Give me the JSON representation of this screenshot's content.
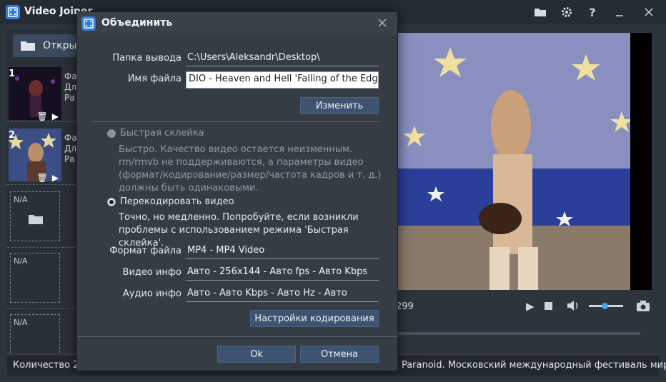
{
  "app": {
    "title": "Video Joiner",
    "open_button": "Откры",
    "status_left": "Количество 2",
    "status_right": "я Paranoid. Московский международный фестиваль мира",
    "time_display": "299",
    "clips": [
      {
        "index": "1",
        "side_lines": [
          "Фа",
          "Дл",
          "Ра"
        ]
      },
      {
        "index": "2",
        "side_lines": [
          "Фа",
          "Дл",
          "Ра"
        ]
      }
    ],
    "empty_slot_label": "N/A"
  },
  "dialog": {
    "title": "Объединить",
    "output_folder_label": "Папка вывода",
    "output_folder_value": "C:\\Users\\Aleksandr\\Desktop\\",
    "filename_label": "Имя файла",
    "filename_value": "DIO - Heaven and Hell 'Falling of the Edge o",
    "change_button": "Изменить",
    "fast_join_label": "Быстрая склейка",
    "fast_join_desc": "Быстро. Качество видео остается неизменным. rm/rmvb не поддерживаются, а параметры видео (формат/кодирование/размер/частота кадров и т. д.) должны быть одинаковыми.",
    "reencode_label": "Перекодировать видео",
    "reencode_desc": "Точно, но медленно. Попробуйте, если возникли проблемы с использованием режима 'Быстрая склейка'.",
    "format_label": "Формат файла",
    "format_value": "MP4 - MP4 Video",
    "video_info_label": "Видео инфо",
    "video_info_value": "Авто - 256x144 - Авто fps - Авто Kbps",
    "audio_info_label": "Аудио инфо",
    "audio_info_value": "Авто - Авто Kbps - Авто Hz - Авто",
    "encode_settings_button": "Настройки кодирования",
    "ok_button": "Ok",
    "cancel_button": "Отмена"
  }
}
